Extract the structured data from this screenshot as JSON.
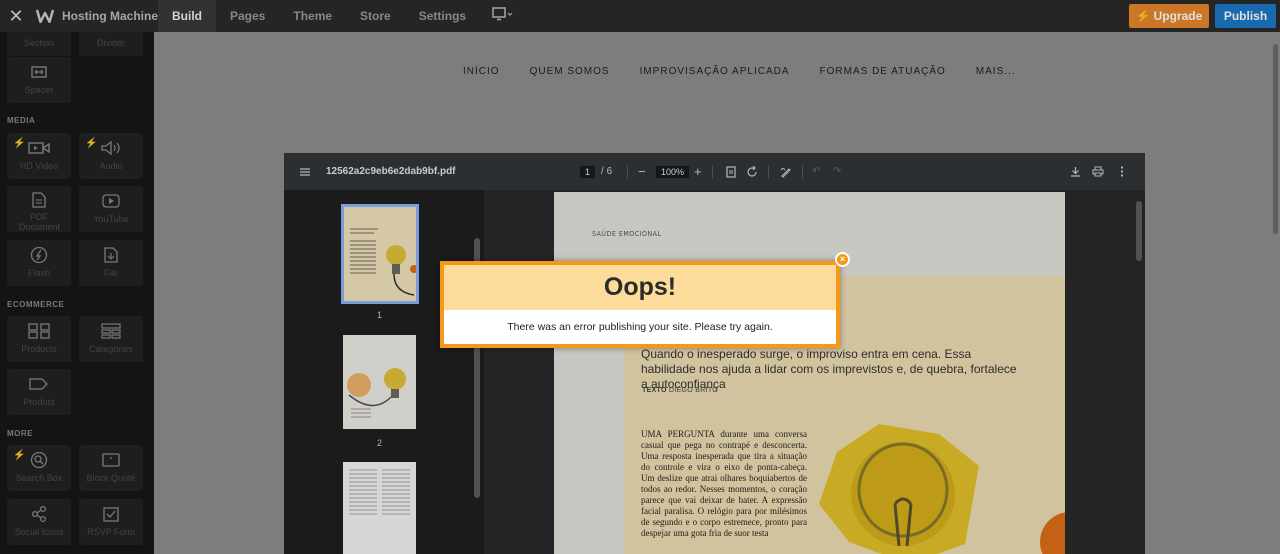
{
  "topbar": {
    "site_name": "Hosting Machine",
    "tabs": [
      "Build",
      "Pages",
      "Theme",
      "Store",
      "Settings"
    ],
    "upgrade_label": "Upgrade",
    "publish_label": "Publish",
    "colors": {
      "upgrade": "#e8882b",
      "publish": "#1d78c6"
    }
  },
  "sidebar": {
    "partial_labels": [
      "Section",
      "Divider"
    ],
    "spacer_label": "Spacer",
    "sections": {
      "media": "MEDIA",
      "ecommerce": "ECOMMERCE",
      "more": "MORE"
    },
    "media_items": [
      "HD Video",
      "Audio",
      "PDF Document",
      "YouTube",
      "Flash",
      "File"
    ],
    "ecommerce_items": [
      "Products",
      "Categories",
      "Product"
    ],
    "more_items": [
      "Search Box",
      "Block Quote",
      "Social Icons",
      "RSVP Form"
    ]
  },
  "site_nav": [
    "INÍCIO",
    "QUEM SOMOS",
    "IMPROVISAÇÃO APLICADA",
    "FORMAS DE ATUAÇÃO",
    "MAIS..."
  ],
  "pdf": {
    "filename": "12562a2c9eb6e2dab9bf.pdf",
    "current_page": "1",
    "total_pages": "/ 6",
    "zoom": "100%",
    "thumb_numbers": [
      "1",
      "2"
    ],
    "page": {
      "kicker": "SAÚDE EMOCIONAL",
      "lede": "Quando o inesperado surge, o improviso entra em cena. Essa habilidade nos ajuda a lidar com os imprevistos e, de quebra, fortalece a autoconfiança",
      "byline_label": "TEXTO",
      "byline_name": "DIEGO BRITO",
      "body": "UMA PERGUNTA durante uma conversa casual que pega no contrapé e desconcerta. Uma resposta inesperada que tira a situação do controle e vira o eixo de ponta-cabeça. Um deslize que atrai olhares boquiabertos de todos ao redor. Nesses momentos, o coração parece que vai deixar de bater. A expressão facial paralisa. O relógio para por milésimos de segundo e o corpo estremece, pronto para despejar uma gota fria de suor testa"
    }
  },
  "dialog": {
    "title": "Oops!",
    "message": "There was an error publishing your site. Please try again.",
    "close_glyph": "×",
    "colors": {
      "border": "#f39a1a",
      "header": "#fddc9b"
    }
  }
}
